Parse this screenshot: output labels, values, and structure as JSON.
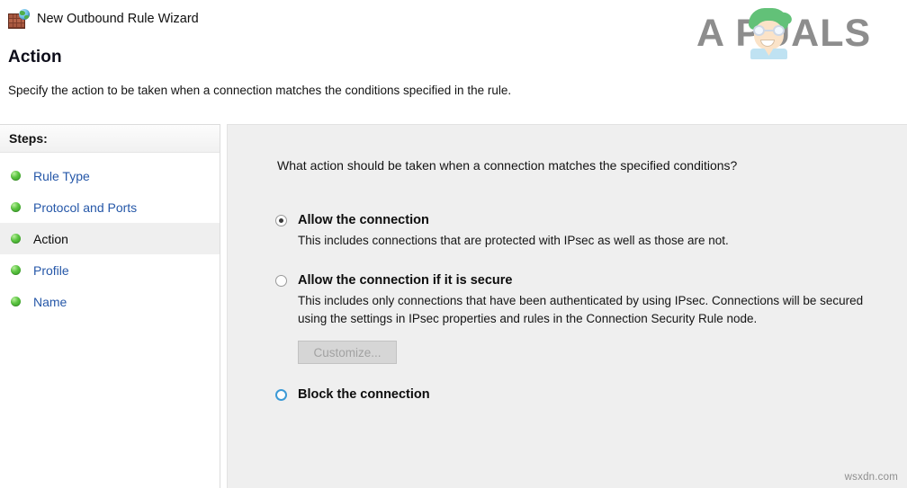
{
  "window": {
    "title": "New Outbound Rule Wizard",
    "icon": "firewall-brick-globe-icon"
  },
  "header": {
    "page_title": "Action",
    "subtitle": "Specify the action to be taken when a connection matches the conditions specified in the rule."
  },
  "branding": {
    "logo_text": "A  PUALS",
    "logo_color": "#8d8d8d",
    "mascot": "appuals-mascot-icon"
  },
  "sidebar": {
    "header": "Steps:",
    "items": [
      {
        "label": "Rule Type",
        "state": "completed"
      },
      {
        "label": "Protocol and Ports",
        "state": "completed"
      },
      {
        "label": "Action",
        "state": "current"
      },
      {
        "label": "Profile",
        "state": "completed"
      },
      {
        "label": "Name",
        "state": "completed"
      }
    ],
    "link_color": "#2557a8",
    "current_bg": "#efefef",
    "bullet_color": "#5cc442"
  },
  "main": {
    "question": "What action should be taken when a connection matches the specified conditions?",
    "options": [
      {
        "title": "Allow the connection",
        "description": "This includes connections that are protected with IPsec as well as those are not.",
        "selected": true,
        "hovered": false
      },
      {
        "title": "Allow the connection if it is secure",
        "description": "This includes only connections that have been authenticated by using IPsec.  Connections will be secured using the settings in IPsec properties and rules in the Connection Security Rule node.",
        "selected": false,
        "hovered": false,
        "button": {
          "label": "Customize...",
          "enabled": false
        }
      },
      {
        "title": "Block the connection",
        "description": "",
        "selected": false,
        "hovered": true
      }
    ],
    "background": "#efefef",
    "hover_ring_color": "#3c9ad6"
  },
  "watermark": "wsxdn.com"
}
